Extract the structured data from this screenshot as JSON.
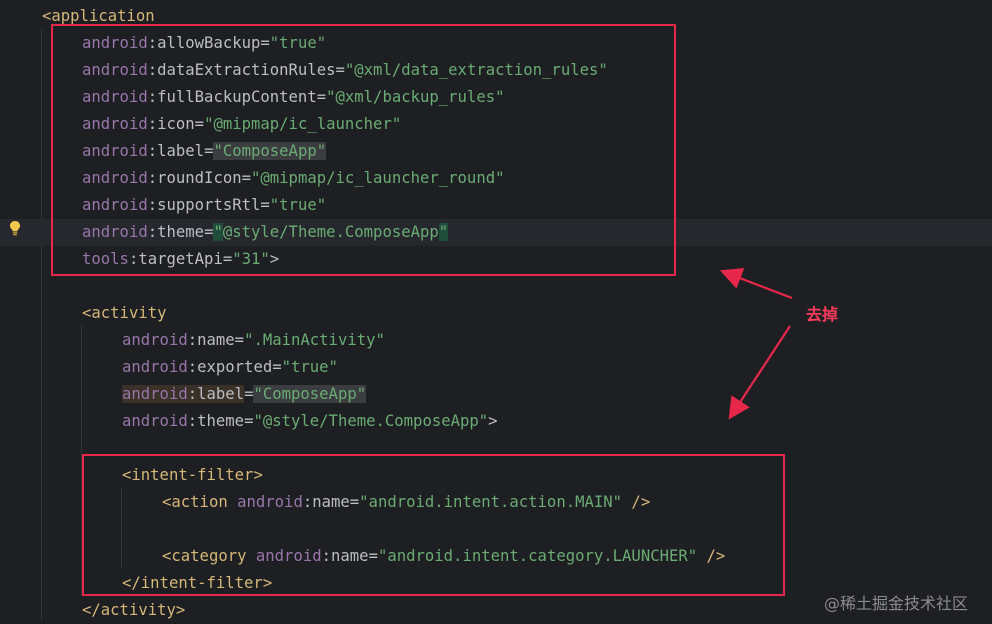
{
  "editor": {
    "lines": [
      {
        "indent": 0,
        "tokens": [
          [
            "tag",
            "<application"
          ]
        ]
      },
      {
        "indent": 1,
        "tokens": [
          [
            "ns",
            "android"
          ],
          [
            "pun",
            ":"
          ],
          [
            "attr",
            "allowBackup"
          ],
          [
            "pun",
            "="
          ],
          [
            "val",
            "\"true\""
          ]
        ]
      },
      {
        "indent": 1,
        "tokens": [
          [
            "ns",
            "android"
          ],
          [
            "pun",
            ":"
          ],
          [
            "attr",
            "dataExtractionRules"
          ],
          [
            "pun",
            "="
          ],
          [
            "val",
            "\"@xml/data_extraction_rules\""
          ]
        ]
      },
      {
        "indent": 1,
        "tokens": [
          [
            "ns",
            "android"
          ],
          [
            "pun",
            ":"
          ],
          [
            "attr",
            "fullBackupContent"
          ],
          [
            "pun",
            "="
          ],
          [
            "val",
            "\"@xml/backup_rules\""
          ]
        ]
      },
      {
        "indent": 1,
        "tokens": [
          [
            "ns",
            "android"
          ],
          [
            "pun",
            ":"
          ],
          [
            "attr",
            "icon"
          ],
          [
            "pun",
            "="
          ],
          [
            "val",
            "\"@mipmap/ic_launcher\""
          ]
        ]
      },
      {
        "indent": 1,
        "tokens": [
          [
            "ns",
            "android"
          ],
          [
            "pun",
            ":"
          ],
          [
            "attr",
            "label"
          ],
          [
            "pun",
            "="
          ],
          [
            "val hl-val",
            "\"ComposeApp\""
          ]
        ]
      },
      {
        "indent": 1,
        "tokens": [
          [
            "ns",
            "android"
          ],
          [
            "pun",
            ":"
          ],
          [
            "attr",
            "roundIcon"
          ],
          [
            "pun",
            "="
          ],
          [
            "val",
            "\"@mipmap/ic_launcher_round\""
          ]
        ]
      },
      {
        "indent": 1,
        "tokens": [
          [
            "ns",
            "android"
          ],
          [
            "pun",
            ":"
          ],
          [
            "attr",
            "supportsRtl"
          ],
          [
            "pun",
            "="
          ],
          [
            "val",
            "\"true\""
          ]
        ]
      },
      {
        "indent": 1,
        "current": true,
        "tokens": [
          [
            "ns",
            "android"
          ],
          [
            "pun",
            ":"
          ],
          [
            "attr",
            "theme"
          ],
          [
            "pun",
            "="
          ],
          [
            "caret-box",
            "\""
          ],
          [
            "val",
            "@style/Theme.ComposeApp"
          ],
          [
            "caret-box",
            "\""
          ]
        ]
      },
      {
        "indent": 1,
        "tokens": [
          [
            "ns",
            "tools"
          ],
          [
            "pun",
            ":"
          ],
          [
            "attr",
            "targetApi"
          ],
          [
            "pun",
            "="
          ],
          [
            "val",
            "\"31\""
          ],
          [
            "pun",
            ">"
          ]
        ]
      },
      {
        "indent": 0,
        "tokens": []
      },
      {
        "indent": 1,
        "tokens": [
          [
            "tag",
            "<activity"
          ]
        ]
      },
      {
        "indent": 2,
        "tokens": [
          [
            "ns",
            "android"
          ],
          [
            "pun",
            ":"
          ],
          [
            "attr",
            "name"
          ],
          [
            "pun",
            "="
          ],
          [
            "val",
            "\".MainActivity\""
          ]
        ]
      },
      {
        "indent": 2,
        "tokens": [
          [
            "ns",
            "android"
          ],
          [
            "pun",
            ":"
          ],
          [
            "attr",
            "exported"
          ],
          [
            "pun",
            "="
          ],
          [
            "val",
            "\"true\""
          ]
        ]
      },
      {
        "indent": 2,
        "tokens": [
          [
            "ns hl-attr",
            "android"
          ],
          [
            "pun hl-attr",
            ":"
          ],
          [
            "attr hl-attr",
            "label"
          ],
          [
            "pun",
            "="
          ],
          [
            "val hl-val",
            "\"ComposeApp\""
          ]
        ]
      },
      {
        "indent": 2,
        "tokens": [
          [
            "ns",
            "android"
          ],
          [
            "pun",
            ":"
          ],
          [
            "attr",
            "theme"
          ],
          [
            "pun",
            "="
          ],
          [
            "val",
            "\"@style/Theme.ComposeApp\""
          ],
          [
            "pun",
            ">"
          ]
        ]
      },
      {
        "indent": 0,
        "tokens": []
      },
      {
        "indent": 2,
        "tokens": [
          [
            "tag",
            "<intent-filter"
          ],
          [
            "tag",
            ">"
          ]
        ]
      },
      {
        "indent": 3,
        "tokens": [
          [
            "tag",
            "<action "
          ],
          [
            "ns",
            "android"
          ],
          [
            "pun",
            ":"
          ],
          [
            "attr",
            "name"
          ],
          [
            "pun",
            "="
          ],
          [
            "val",
            "\"android.intent.action.MAIN\""
          ],
          [
            "tag",
            " />"
          ]
        ]
      },
      {
        "indent": 0,
        "tokens": []
      },
      {
        "indent": 3,
        "tokens": [
          [
            "tag",
            "<category "
          ],
          [
            "ns",
            "android"
          ],
          [
            "pun",
            ":"
          ],
          [
            "attr",
            "name"
          ],
          [
            "pun",
            "="
          ],
          [
            "val",
            "\"android.intent.category.LAUNCHER\""
          ],
          [
            "tag",
            " />"
          ]
        ]
      },
      {
        "indent": 2,
        "tokens": [
          [
            "tag",
            "</intent-filter>"
          ]
        ]
      },
      {
        "indent": 1,
        "tokens": [
          [
            "tag",
            "</activity>"
          ]
        ]
      }
    ]
  },
  "annotation": {
    "label": "去掉",
    "color": "#e8284b"
  },
  "watermark": "@稀土掘金技术社区",
  "icons": {
    "bulb": "lightbulb-icon"
  }
}
